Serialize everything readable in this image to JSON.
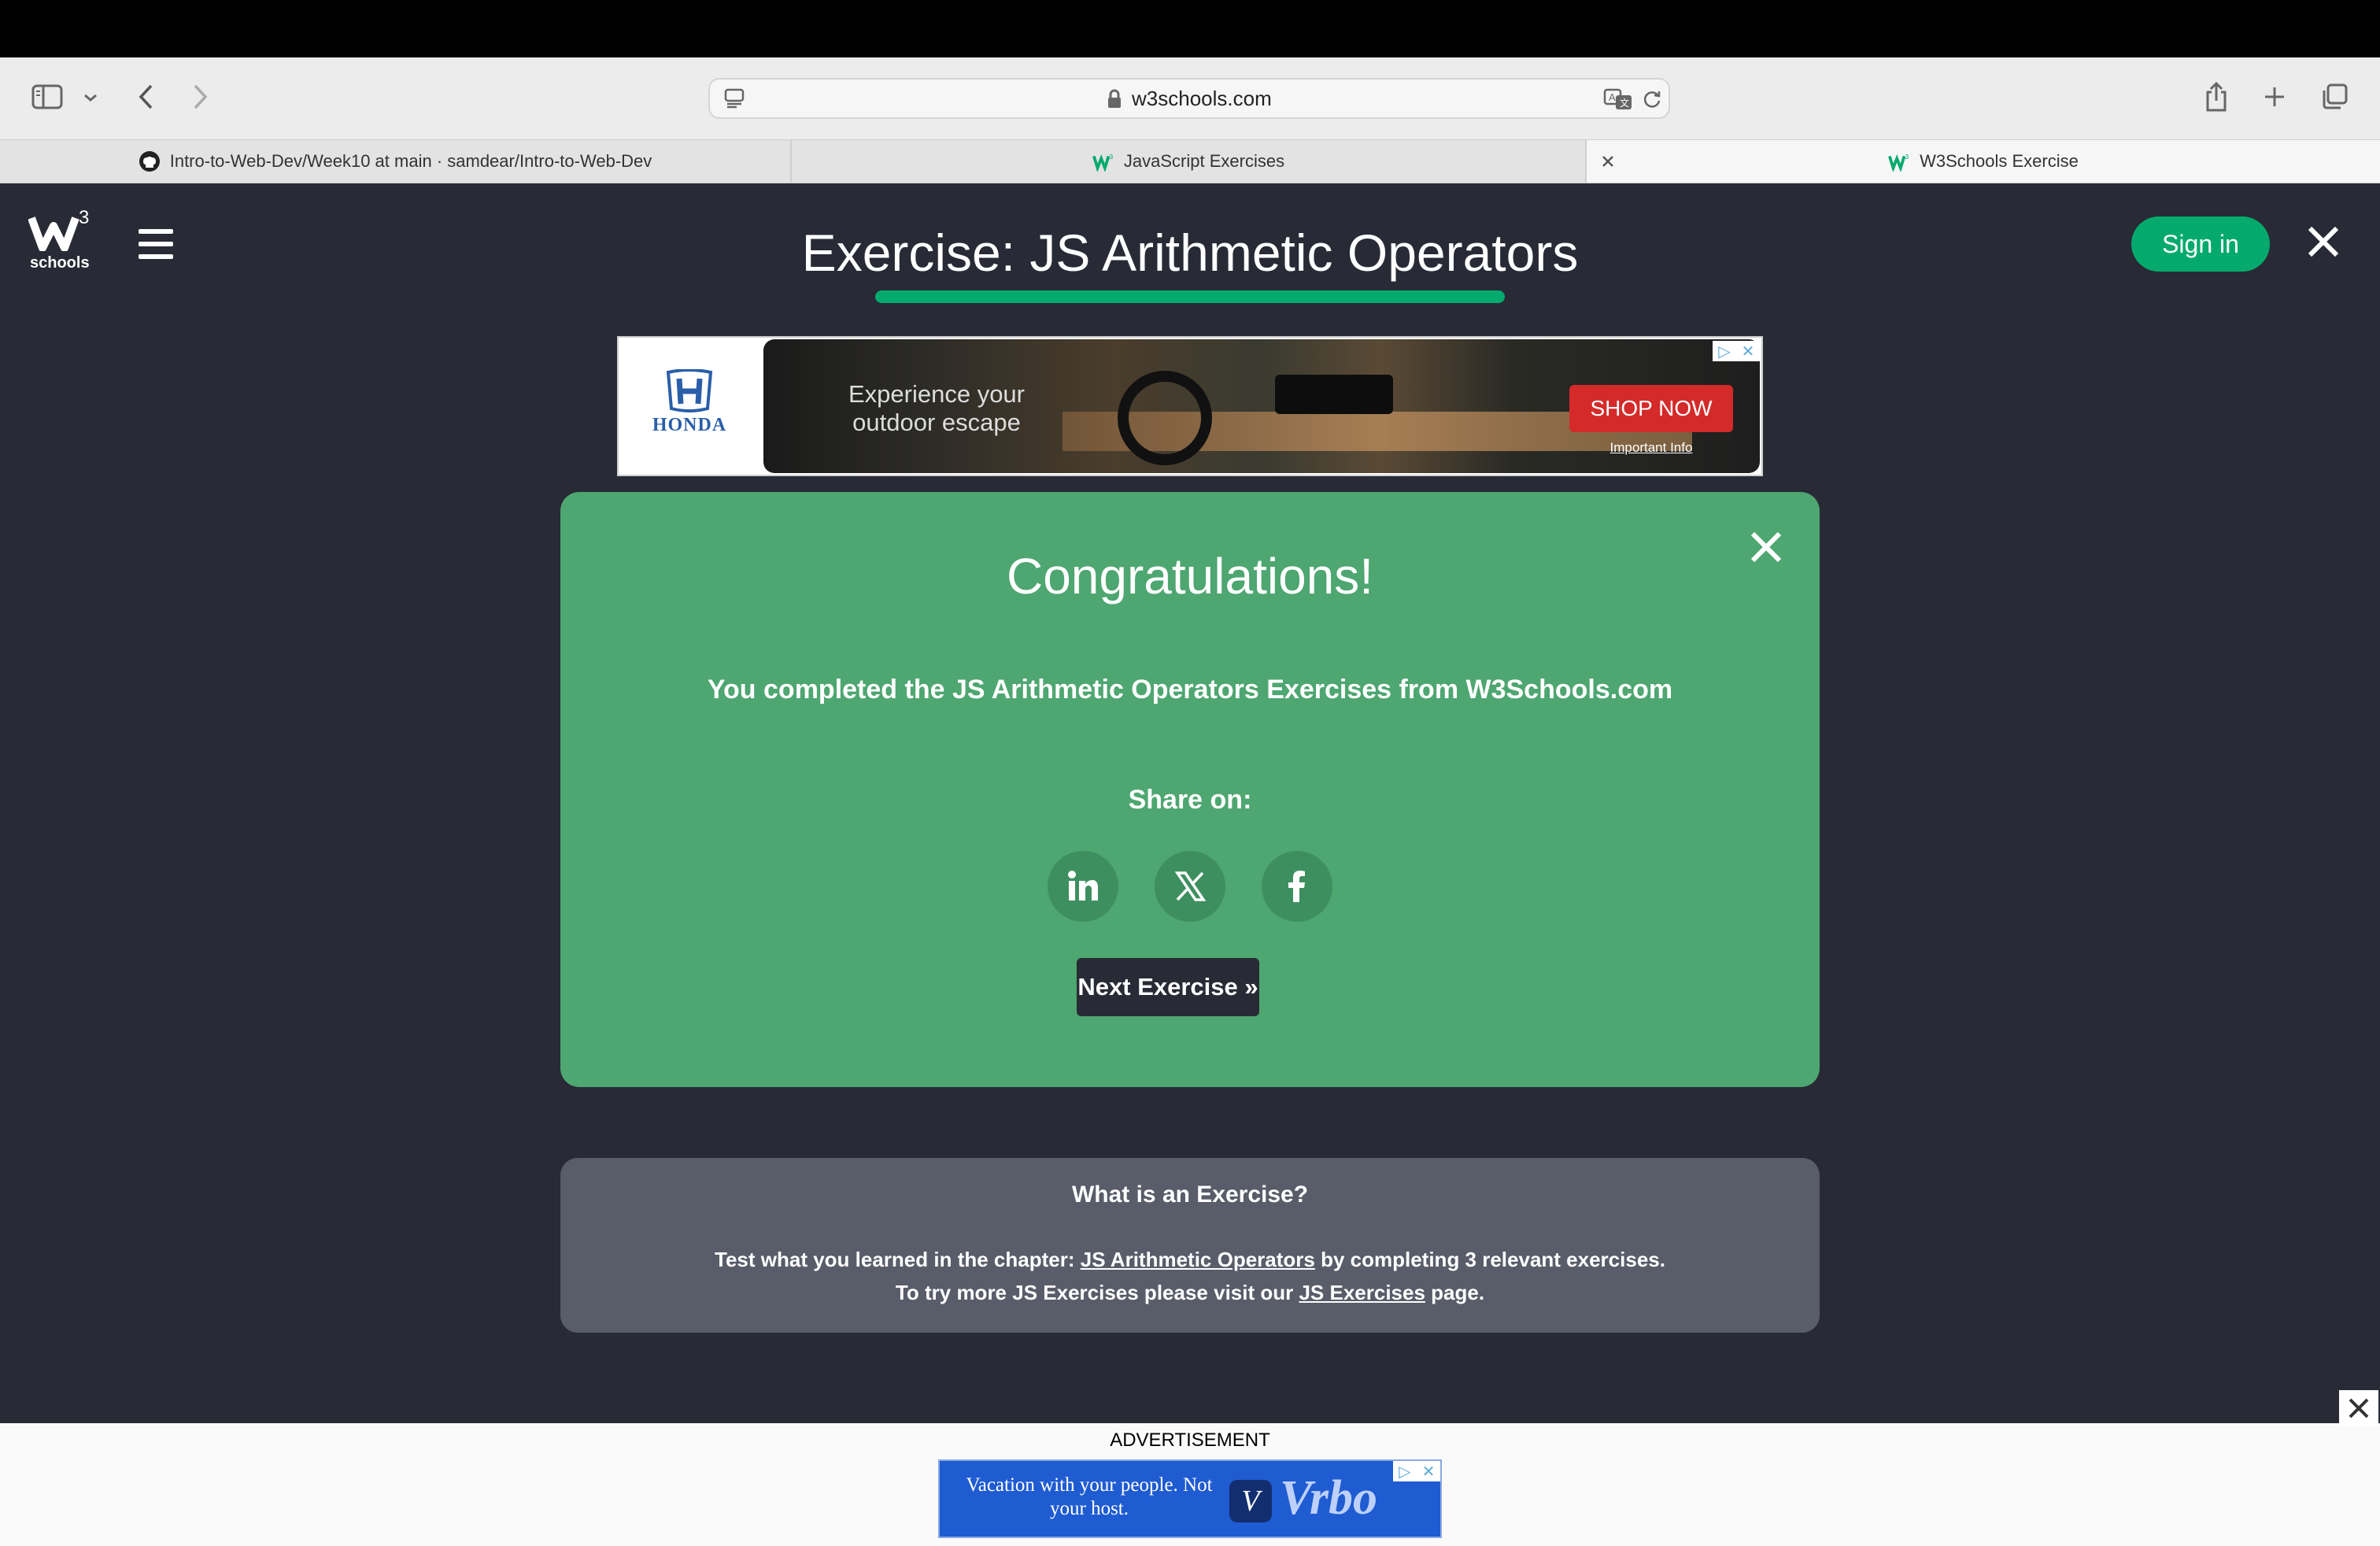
{
  "browser": {
    "url": "w3schools.com",
    "tabs": [
      {
        "label": "Intro-to-Web-Dev/Week10 at main · samdear/Intro-to-Web-Dev",
        "favicon": "github-icon"
      },
      {
        "label": "JavaScript Exercises",
        "favicon": "w3schools-icon"
      },
      {
        "label": "W3Schools Exercise",
        "favicon": "w3schools-icon"
      }
    ]
  },
  "header": {
    "logo_sup": "3",
    "logo_word": "schools",
    "title": "Exercise: JS Arithmetic Operators",
    "signin_label": "Sign in"
  },
  "ad_top": {
    "brand": "HONDA",
    "headline": "Experience your outdoor escape",
    "cta": "SHOP NOW",
    "info": "Important Info"
  },
  "congrats": {
    "title": "Congratulations!",
    "message": "You completed the JS Arithmetic Operators Exercises from W3Schools.com",
    "share_label": "Share on:",
    "share_icons": [
      "linkedin-icon",
      "x-icon",
      "facebook-icon"
    ],
    "next_label": "Next Exercise »"
  },
  "info_box": {
    "title": "What is an Exercise?",
    "line1_prefix": "Test what you learned in the chapter: ",
    "line1_link": "JS Arithmetic Operators",
    "line1_suffix": " by completing 3 relevant exercises.",
    "line2_prefix": "To try more JS Exercises please visit our ",
    "line2_link": "JS Exercises",
    "line2_suffix": " page."
  },
  "ad_bottom": {
    "label": "ADVERTISEMENT",
    "text": "Vacation with your people. Not your host.",
    "brand": "Vrbo"
  },
  "colors": {
    "w3_green": "#04aa6d",
    "page_bg": "#282a35",
    "congrats_bg": "#4ea671",
    "info_bg": "#595c69"
  }
}
